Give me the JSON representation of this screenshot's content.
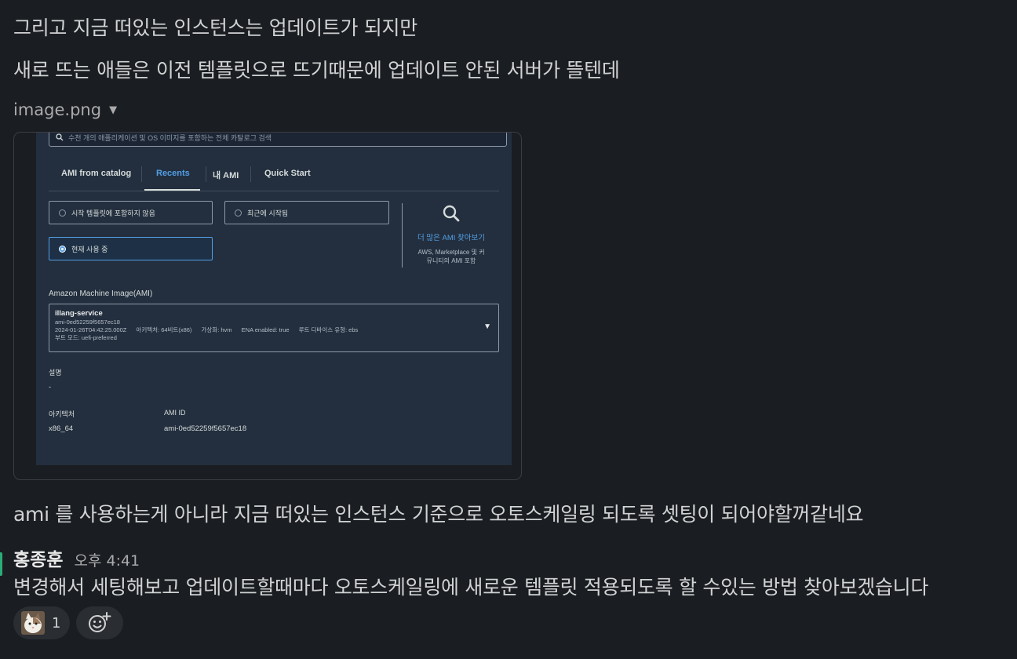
{
  "messages": {
    "line1": "그리고 지금 떠있는 인스턴스는 업데이트가 되지만",
    "line2": "새로 뜨는 애들은 이전 템플릿으로 뜨기때문에 업데이트 안된 서버가 뜰텐데",
    "line3": "ami 를 사용하는게 아니라 지금 떠있는 인스턴스 기준으로 오토스케일링 되도록 셋팅이 되어야할꺼같네요",
    "line4": "변경해서 세팅해보고 업데이트할때마다 오토스케일링에 새로운 템플릿 적용되도록 할 수있는 방법 찾아보겠습니다"
  },
  "attachment": {
    "filename": "image.png"
  },
  "screenshot": {
    "search_placeholder": "수천 개의 애플리케이션 및 OS 이미지를 포함하는 전체 카탈로그 검색",
    "tabs": [
      {
        "label": "AMI from catalog",
        "active": false
      },
      {
        "label": "Recents",
        "active": true
      },
      {
        "label": "내 AMI",
        "active": false
      },
      {
        "label": "Quick Start",
        "active": false
      }
    ],
    "radio_options": [
      {
        "label": "시작 템플릿에 포함하지 않음",
        "selected": false
      },
      {
        "label": "최근에 시작됨",
        "selected": false
      },
      {
        "label": "현재 사용 중",
        "selected": true
      }
    ],
    "more_ami": {
      "link": "더 많은 AMI 찾아보기",
      "desc1": "AWS, Marketplace 및 커",
      "desc2": "뮤니티의 AMI 포함"
    },
    "ami_label": "Amazon Machine Image(AMI)",
    "ami": {
      "name": "illang-service",
      "id_line": "ami-0ed52259f5657ec18",
      "date": "2024-01-26T04:42:25.000Z",
      "arch": "아키텍처: 64비트(x86)",
      "virt": "가상화: hvm",
      "ena": "ENA enabled: true",
      "root": "루트 디바이스 유형: ebs",
      "boot": "부트 모드: uefi-preferred"
    },
    "description_label": "설명",
    "description_value": "-",
    "arch_label": "아키텍처",
    "arch_value": "x86_64",
    "amiid_label": "AMI ID",
    "amiid_value": "ami-0ed52259f5657ec18"
  },
  "sender": {
    "name": "홍종훈",
    "time": "오후 4:41"
  },
  "reaction": {
    "count": "1",
    "emoji": "cat-face-icon"
  },
  "colors": {
    "background": "#1a1d21",
    "text": "#d1d2d3",
    "aws_bg": "#232f3e",
    "aws_link": "#539fe5"
  }
}
